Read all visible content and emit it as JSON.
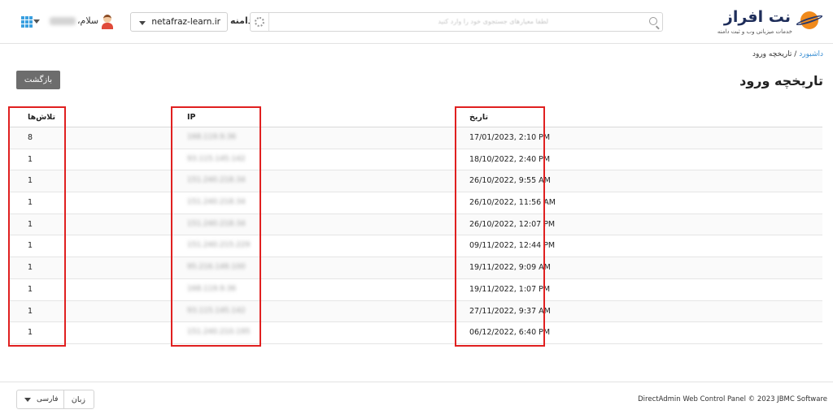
{
  "header": {
    "greeting": "سلام،",
    "domain_label": "دامنه",
    "domain_value": "netafraz-learn.ir",
    "search_placeholder": "لطفا معیارهای جستجوی خود را وارد کنید",
    "logo_name": "نت افراز",
    "logo_tagline": "خدمات میزبانی وب و ثبت دامنه"
  },
  "breadcrumb": {
    "home": "داشبورد",
    "separator": "/",
    "current": "تاریخچه ورود"
  },
  "page": {
    "title": "تاریخچه ورود",
    "back_label": "بازگشت"
  },
  "table": {
    "columns": {
      "date": "تاریخ",
      "ip": "IP",
      "attempts": "تلاش‌ها"
    },
    "rows": [
      {
        "date": "17/01/2023, 2:10 PM",
        "ip": "168.119.9.36",
        "attempts": "8"
      },
      {
        "date": "18/10/2022, 2:40 PM",
        "ip": "93.115.145.142",
        "attempts": "1"
      },
      {
        "date": "26/10/2022, 9:55 AM",
        "ip": "151.240.218.34",
        "attempts": "1"
      },
      {
        "date": "26/10/2022, 11:56 AM",
        "ip": "151.240.218.34",
        "attempts": "1"
      },
      {
        "date": "26/10/2022, 12:07 PM",
        "ip": "151.240.218.34",
        "attempts": "1"
      },
      {
        "date": "09/11/2022, 12:44 PM",
        "ip": "151.240.215.229",
        "attempts": "1"
      },
      {
        "date": "19/11/2022, 9:09 AM",
        "ip": "95.216.149.100",
        "attempts": "1"
      },
      {
        "date": "19/11/2022, 1:07 PM",
        "ip": "168.119.9.36",
        "attempts": "1"
      },
      {
        "date": "27/11/2022, 9:37 AM",
        "ip": "93.115.145.142",
        "attempts": "1"
      },
      {
        "date": "06/12/2022, 6:40 PM",
        "ip": "151.240.210.195",
        "attempts": "1"
      }
    ]
  },
  "footer": {
    "language_label": "زبان",
    "language_value": "فارسی",
    "copyright": "DirectAdmin Web Control Panel © 2023 JBMC Software"
  },
  "colors": {
    "highlight": "#e02020",
    "link": "#3b8fd3",
    "grid_icon": "#3aa0e0",
    "logo_orange": "#f08a1c",
    "logo_navy": "#1e2d5a"
  }
}
